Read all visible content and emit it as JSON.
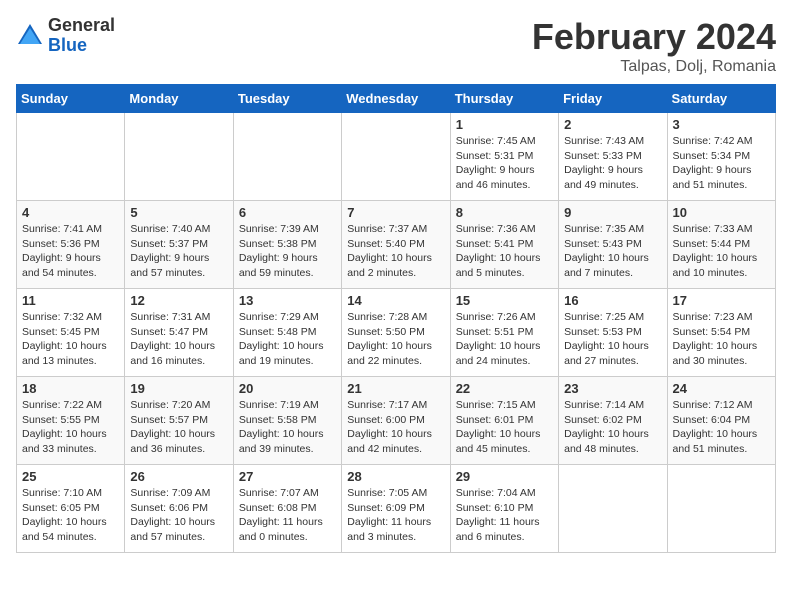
{
  "logo": {
    "general": "General",
    "blue": "Blue"
  },
  "title": "February 2024",
  "subtitle": "Talpas, Dolj, Romania",
  "headers": [
    "Sunday",
    "Monday",
    "Tuesday",
    "Wednesday",
    "Thursday",
    "Friday",
    "Saturday"
  ],
  "weeks": [
    [
      {
        "day": "",
        "info": ""
      },
      {
        "day": "",
        "info": ""
      },
      {
        "day": "",
        "info": ""
      },
      {
        "day": "",
        "info": ""
      },
      {
        "day": "1",
        "info": "Sunrise: 7:45 AM\nSunset: 5:31 PM\nDaylight: 9 hours\nand 46 minutes."
      },
      {
        "day": "2",
        "info": "Sunrise: 7:43 AM\nSunset: 5:33 PM\nDaylight: 9 hours\nand 49 minutes."
      },
      {
        "day": "3",
        "info": "Sunrise: 7:42 AM\nSunset: 5:34 PM\nDaylight: 9 hours\nand 51 minutes."
      }
    ],
    [
      {
        "day": "4",
        "info": "Sunrise: 7:41 AM\nSunset: 5:36 PM\nDaylight: 9 hours\nand 54 minutes."
      },
      {
        "day": "5",
        "info": "Sunrise: 7:40 AM\nSunset: 5:37 PM\nDaylight: 9 hours\nand 57 minutes."
      },
      {
        "day": "6",
        "info": "Sunrise: 7:39 AM\nSunset: 5:38 PM\nDaylight: 9 hours\nand 59 minutes."
      },
      {
        "day": "7",
        "info": "Sunrise: 7:37 AM\nSunset: 5:40 PM\nDaylight: 10 hours\nand 2 minutes."
      },
      {
        "day": "8",
        "info": "Sunrise: 7:36 AM\nSunset: 5:41 PM\nDaylight: 10 hours\nand 5 minutes."
      },
      {
        "day": "9",
        "info": "Sunrise: 7:35 AM\nSunset: 5:43 PM\nDaylight: 10 hours\nand 7 minutes."
      },
      {
        "day": "10",
        "info": "Sunrise: 7:33 AM\nSunset: 5:44 PM\nDaylight: 10 hours\nand 10 minutes."
      }
    ],
    [
      {
        "day": "11",
        "info": "Sunrise: 7:32 AM\nSunset: 5:45 PM\nDaylight: 10 hours\nand 13 minutes."
      },
      {
        "day": "12",
        "info": "Sunrise: 7:31 AM\nSunset: 5:47 PM\nDaylight: 10 hours\nand 16 minutes."
      },
      {
        "day": "13",
        "info": "Sunrise: 7:29 AM\nSunset: 5:48 PM\nDaylight: 10 hours\nand 19 minutes."
      },
      {
        "day": "14",
        "info": "Sunrise: 7:28 AM\nSunset: 5:50 PM\nDaylight: 10 hours\nand 22 minutes."
      },
      {
        "day": "15",
        "info": "Sunrise: 7:26 AM\nSunset: 5:51 PM\nDaylight: 10 hours\nand 24 minutes."
      },
      {
        "day": "16",
        "info": "Sunrise: 7:25 AM\nSunset: 5:53 PM\nDaylight: 10 hours\nand 27 minutes."
      },
      {
        "day": "17",
        "info": "Sunrise: 7:23 AM\nSunset: 5:54 PM\nDaylight: 10 hours\nand 30 minutes."
      }
    ],
    [
      {
        "day": "18",
        "info": "Sunrise: 7:22 AM\nSunset: 5:55 PM\nDaylight: 10 hours\nand 33 minutes."
      },
      {
        "day": "19",
        "info": "Sunrise: 7:20 AM\nSunset: 5:57 PM\nDaylight: 10 hours\nand 36 minutes."
      },
      {
        "day": "20",
        "info": "Sunrise: 7:19 AM\nSunset: 5:58 PM\nDaylight: 10 hours\nand 39 minutes."
      },
      {
        "day": "21",
        "info": "Sunrise: 7:17 AM\nSunset: 6:00 PM\nDaylight: 10 hours\nand 42 minutes."
      },
      {
        "day": "22",
        "info": "Sunrise: 7:15 AM\nSunset: 6:01 PM\nDaylight: 10 hours\nand 45 minutes."
      },
      {
        "day": "23",
        "info": "Sunrise: 7:14 AM\nSunset: 6:02 PM\nDaylight: 10 hours\nand 48 minutes."
      },
      {
        "day": "24",
        "info": "Sunrise: 7:12 AM\nSunset: 6:04 PM\nDaylight: 10 hours\nand 51 minutes."
      }
    ],
    [
      {
        "day": "25",
        "info": "Sunrise: 7:10 AM\nSunset: 6:05 PM\nDaylight: 10 hours\nand 54 minutes."
      },
      {
        "day": "26",
        "info": "Sunrise: 7:09 AM\nSunset: 6:06 PM\nDaylight: 10 hours\nand 57 minutes."
      },
      {
        "day": "27",
        "info": "Sunrise: 7:07 AM\nSunset: 6:08 PM\nDaylight: 11 hours\nand 0 minutes."
      },
      {
        "day": "28",
        "info": "Sunrise: 7:05 AM\nSunset: 6:09 PM\nDaylight: 11 hours\nand 3 minutes."
      },
      {
        "day": "29",
        "info": "Sunrise: 7:04 AM\nSunset: 6:10 PM\nDaylight: 11 hours\nand 6 minutes."
      },
      {
        "day": "",
        "info": ""
      },
      {
        "day": "",
        "info": ""
      }
    ]
  ]
}
